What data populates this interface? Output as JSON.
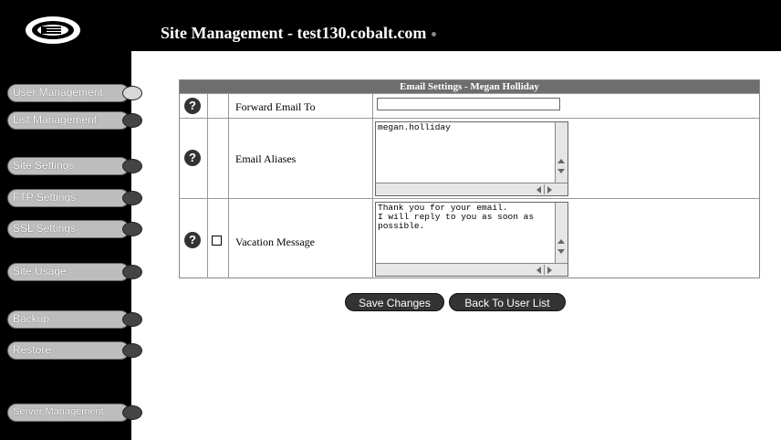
{
  "header": {
    "title": "Site Management - test130.cobalt.com"
  },
  "nav": {
    "items": [
      {
        "label": "User Management",
        "active": true
      },
      {
        "label": "List Management",
        "active": false
      },
      {
        "label": "Site Settings",
        "active": false
      },
      {
        "label": "FTP Settings",
        "active": false
      },
      {
        "label": "SSL Settings",
        "active": false
      },
      {
        "label": "Site Usage",
        "active": false
      },
      {
        "label": "Backup",
        "active": false
      },
      {
        "label": "Restore",
        "active": false
      },
      {
        "label": "Server Management",
        "active": false
      }
    ]
  },
  "settings": {
    "title": "Email Settings - Megan Holliday",
    "rows": [
      {
        "label": "Forward Email To",
        "value": ""
      },
      {
        "label": "Email Aliases",
        "value": "megan.holliday"
      },
      {
        "label": "Vacation Message",
        "enabled": false,
        "value": "Thank you for your email.\nI will reply to you as soon as\npossible."
      }
    ]
  },
  "actions": {
    "save_label": "Save Changes",
    "back_label": "Back To User List"
  },
  "icons": {
    "help": "help-question-icon",
    "logo": "cobalt-logo"
  }
}
